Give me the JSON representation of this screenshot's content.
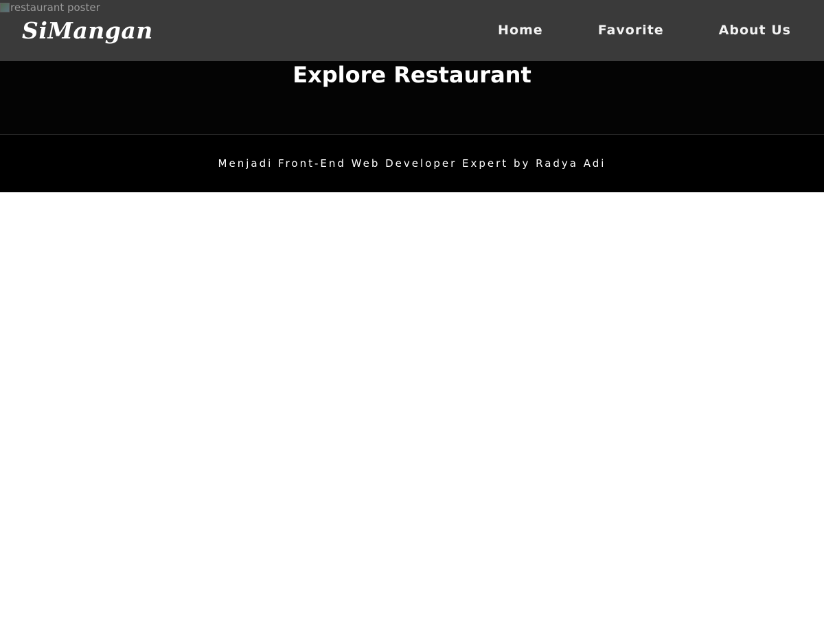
{
  "header": {
    "poster_alt": "restaurant poster",
    "brand": "SiMangan",
    "nav": [
      {
        "label": "Home"
      },
      {
        "label": "Favorite"
      },
      {
        "label": "About Us"
      }
    ]
  },
  "main": {
    "title": "Explore Restaurant"
  },
  "footer": {
    "text": "Menjadi Front-End Web Developer Expert by Radya Adi"
  },
  "colors": {
    "header_bg": "#3a3a3a",
    "hero_bg": "#040404",
    "footer_bg": "#000000",
    "text": "#ffffff"
  }
}
